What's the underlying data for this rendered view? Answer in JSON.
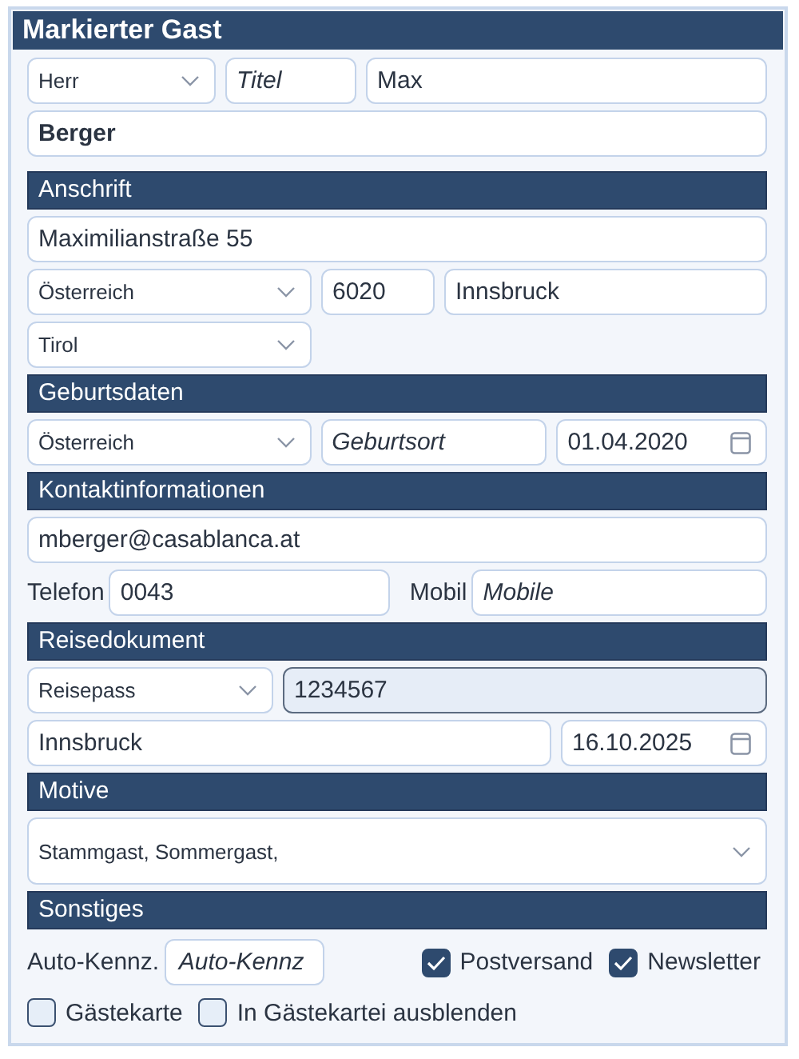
{
  "panel": {
    "title": "Markierter Gast"
  },
  "sections": [
    {
      "rows": [
        {
          "fields": [
            {
              "kind": "select",
              "value": "Herr"
            },
            {
              "kind": "input",
              "placeholder": "Titel",
              "disabled": false
            },
            {
              "kind": "input",
              "value": "Max",
              "disabled": false
            }
          ]
        },
        {
          "fields": [
            {
              "kind": "input",
              "value": "Berger",
              "disabled": false
            }
          ]
        }
      ]
    },
    {
      "heading": "Anschrift",
      "rows": [
        {
          "fields": [
            {
              "kind": "input",
              "value": "Maximilianstraße 55",
              "disabled": false
            }
          ]
        },
        {
          "fields": [
            {
              "kind": "select",
              "value": "Österreich"
            },
            {
              "kind": "input",
              "value": "6020",
              "disabled": false
            },
            {
              "kind": "input",
              "value": "Innsbruck",
              "disabled": false
            }
          ]
        },
        {
          "fields": [
            {
              "kind": "select",
              "value": "Tirol"
            }
          ]
        }
      ]
    },
    {
      "heading": "Geburtsdaten",
      "rows": [
        {
          "fields": [
            {
              "kind": "select",
              "value": "Österreich"
            },
            {
              "kind": "input",
              "placeholder": "Geburtsort",
              "disabled": false
            },
            {
              "kind": "date",
              "value": "01.04.2020"
            }
          ]
        }
      ]
    },
    {
      "heading": "Kontaktinformationen",
      "rows": [
        {
          "fields": [
            {
              "kind": "input",
              "value": "mberger@casablanca.at",
              "disabled": false
            }
          ]
        },
        {
          "fields": [
            {
              "kind": "label",
              "text": "Telefon"
            },
            {
              "kind": "input",
              "value": "0043",
              "disabled": false
            },
            {
              "kind": "label",
              "text": "Mobil"
            },
            {
              "kind": "input",
              "placeholder": "Mobile",
              "disabled": false
            }
          ]
        }
      ]
    },
    {
      "heading": "Reisedokument",
      "rows": [
        {
          "fields": [
            {
              "kind": "select",
              "value": "Reisepass"
            },
            {
              "kind": "input",
              "value": "1234567",
              "disabled": true
            }
          ]
        },
        {
          "fields": [
            {
              "kind": "input",
              "value": "Innsbruck",
              "disabled": false
            },
            {
              "kind": "date",
              "value": "16.10.2025"
            }
          ]
        }
      ]
    },
    {
      "heading": "Motive",
      "rows": [
        {
          "fields": [
            {
              "kind": "multiselect",
              "value": "Stammgast, Sommergast,"
            }
          ]
        }
      ]
    },
    {
      "heading": "Sonstiges",
      "rows": [
        {
          "fields": [
            {
              "kind": "label",
              "text": "Auto-Kennz."
            },
            {
              "kind": "input",
              "placeholder": "Auto-Kennz",
              "disabled": false
            },
            {
              "kind": "checkbox",
              "label": "Postversand",
              "checked": true
            },
            {
              "kind": "checkbox",
              "label": "Newsletter",
              "checked": true
            }
          ]
        },
        {
          "fields": [
            {
              "kind": "checkbox",
              "label": "Gästekarte",
              "checked": false
            },
            {
              "kind": "checkbox",
              "label": "In Gästekartei ausblenden",
              "checked": false
            }
          ]
        }
      ]
    }
  ]
}
